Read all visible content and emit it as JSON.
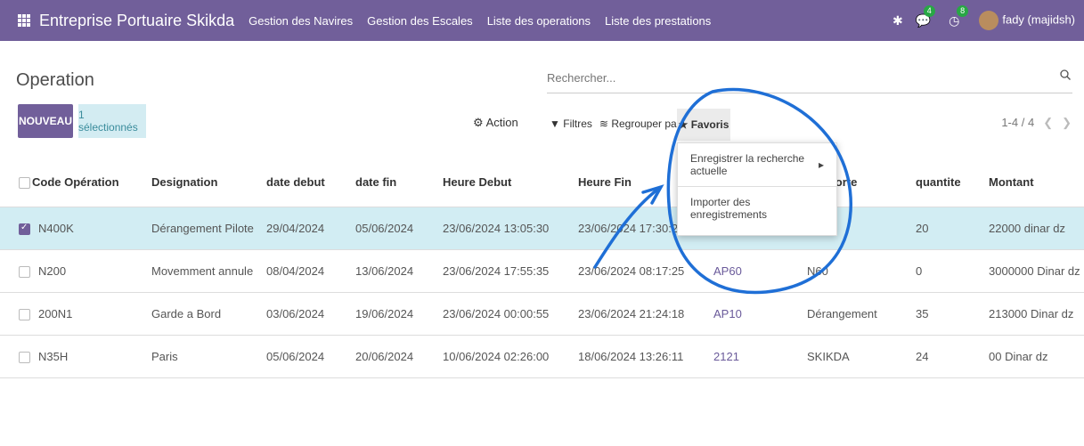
{
  "navbar": {
    "brand": "Entreprise Portuaire Skikda",
    "menu": [
      "Gestion des Navires",
      "Gestion des Escales",
      "Liste des operations",
      "Liste des prestations"
    ],
    "messages_count": "4",
    "activities_count": "8",
    "user": "fady (majidsh)",
    "bar_color": "#715f9a"
  },
  "page": {
    "title": "Operation",
    "new_button": "NOUVEAU",
    "selected_label": "1 sélectionnés",
    "action_label": "Action",
    "search_placeholder": "Rechercher...",
    "filters_label": "Filtres",
    "group_label": "Regrouper par",
    "favorites_label": "Favoris",
    "pager": "1-4 / 4"
  },
  "favorites_menu": {
    "items": [
      "Enregistrer la recherche actuelle",
      "Importer des enregistrements"
    ]
  },
  "table": {
    "columns": [
      "Code Opération",
      "Designation",
      "date debut",
      "date fin",
      "Heure Debut",
      "Heure Fin",
      "",
      "ion Porte",
      "quantite",
      "Montant"
    ],
    "rows": [
      {
        "selected": true,
        "cells": [
          "N400K",
          "Dérangement Pilote",
          "29/04/2024",
          "05/06/2024",
          "23/06/2024 13:05:30",
          "23/06/2024 17:30:29",
          "",
          "nent",
          "20",
          "22000 dinar dz"
        ]
      },
      {
        "selected": false,
        "cells": [
          "N200",
          "Movemment annule",
          "08/04/2024",
          "13/06/2024",
          "23/06/2024 17:55:35",
          "23/06/2024 08:17:25",
          "AP60",
          "N60",
          "0",
          "3000000 Dinar dz"
        ]
      },
      {
        "selected": false,
        "cells": [
          "200N1",
          "Garde a Bord",
          "03/06/2024",
          "19/06/2024",
          "23/06/2024 00:00:55",
          "23/06/2024 21:24:18",
          "AP10",
          "Dérangement",
          "35",
          "213000 Dinar dz"
        ]
      },
      {
        "selected": false,
        "cells": [
          "N35H",
          "Paris",
          "05/06/2024",
          "20/06/2024",
          "10/06/2024 02:26:00",
          "18/06/2024 13:26:11",
          "2121",
          "SKIKDA",
          "24",
          "00 Dinar dz"
        ]
      }
    ]
  }
}
